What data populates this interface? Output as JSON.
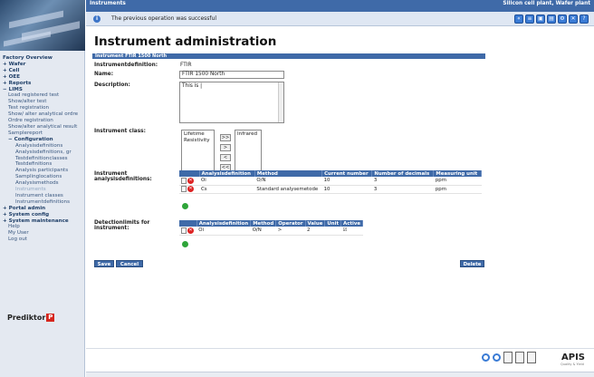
{
  "header": {
    "module": "Instruments",
    "site": "Silicon cell plant, Wafer plant",
    "message": "The previous operation was successful"
  },
  "toolbar": {
    "icons": [
      "back-icon",
      "list-icon",
      "print-icon",
      "save-icon",
      "settings-icon",
      "close-icon",
      "help-icon"
    ]
  },
  "sidebar": {
    "items": [
      {
        "label": "Factory Overview",
        "level": 0,
        "style": "plain"
      },
      {
        "label": "+ Wafer",
        "level": 0,
        "style": "bold"
      },
      {
        "label": "+ Cell",
        "level": 0,
        "style": "bold"
      },
      {
        "label": "+ OEE",
        "level": 0,
        "style": "bold"
      },
      {
        "label": "+ Reports",
        "level": 0,
        "style": "bold"
      },
      {
        "label": "− LIMS",
        "level": 0,
        "style": "bold"
      },
      {
        "label": "Load registered test",
        "level": 1,
        "style": "plain"
      },
      {
        "label": "Show/alter test",
        "level": 1,
        "style": "plain"
      },
      {
        "label": "Test registration",
        "level": 1,
        "style": "plain"
      },
      {
        "label": "Show/ alter analytical ordre",
        "level": 1,
        "style": "plain"
      },
      {
        "label": "Ordre registration",
        "level": 1,
        "style": "plain"
      },
      {
        "label": "Show/alter analytical result",
        "level": 1,
        "style": "plain"
      },
      {
        "label": "Samplereport",
        "level": 1,
        "style": "plain"
      },
      {
        "label": "− Configuration",
        "level": 1,
        "style": "bold"
      },
      {
        "label": "Analysisdefinitions",
        "level": 2,
        "style": "plain"
      },
      {
        "label": "Analysisdefinitions, gr",
        "level": 2,
        "style": "plain"
      },
      {
        "label": "Testdefinitionclasses",
        "level": 2,
        "style": "plain"
      },
      {
        "label": "Testdefinitions",
        "level": 2,
        "style": "plain"
      },
      {
        "label": "Analysis participants",
        "level": 2,
        "style": "plain"
      },
      {
        "label": "Samplinglocations",
        "level": 2,
        "style": "plain"
      },
      {
        "label": "Analysismethods",
        "level": 2,
        "style": "plain"
      },
      {
        "label": "Instruments",
        "level": 2,
        "style": "dim"
      },
      {
        "label": "Instrument classes",
        "level": 2,
        "style": "plain"
      },
      {
        "label": "Instrumentdefinitions",
        "level": 2,
        "style": "plain"
      },
      {
        "label": "+ Portal admin",
        "level": 0,
        "style": "bold"
      },
      {
        "label": "+ System config",
        "level": 0,
        "style": "bold"
      },
      {
        "label": "+ System maintenance",
        "level": 0,
        "style": "bold"
      },
      {
        "label": "Help",
        "level": 1,
        "style": "plain"
      },
      {
        "label": "My User",
        "level": 1,
        "style": "plain"
      },
      {
        "label": "Log out",
        "level": 1,
        "style": "plain"
      }
    ],
    "brand": "Prediktor"
  },
  "page": {
    "title": "Instrument administration",
    "section_title": "Instrument FTIR 1500 North",
    "labels": {
      "definition": "Instrumentdefinition:",
      "name": "Name:",
      "description": "Description:",
      "class": "Instrument class:",
      "analysisdefs": "Instrument analysisdefinitions:",
      "detlimits": "Detectionlimits for instrument:"
    },
    "definition_value": "FTIR",
    "name_value": "FTIR 1500 North",
    "description_value": "This is |",
    "class_available": [
      "Lifetime",
      "Resistivity"
    ],
    "class_selected": [
      "Infrared"
    ],
    "move_buttons": [
      ">>",
      ">",
      "<",
      "<<"
    ],
    "analysis_table": {
      "columns": [
        "Analysisdefinition",
        "Method",
        "Current number",
        "Number of decimals",
        "Measuring unit"
      ],
      "rows": [
        [
          "Oi",
          "O/N",
          "10",
          "3",
          "ppm"
        ],
        [
          "Cs",
          "Standard analysemetode",
          "10",
          "3",
          "ppm"
        ]
      ]
    },
    "detection_table": {
      "columns": [
        "Analysisdefinition",
        "Method",
        "Operator",
        "Value",
        "Unit",
        "Active"
      ],
      "rows": [
        [
          "Oi",
          "O/N",
          ">",
          "2",
          "",
          "☑"
        ]
      ]
    },
    "buttons": {
      "save": "Save",
      "cancel": "Cancel",
      "delete": "Delete"
    }
  },
  "footer": {
    "logo": "APIS",
    "logo_sub": "Quality & Yield"
  }
}
